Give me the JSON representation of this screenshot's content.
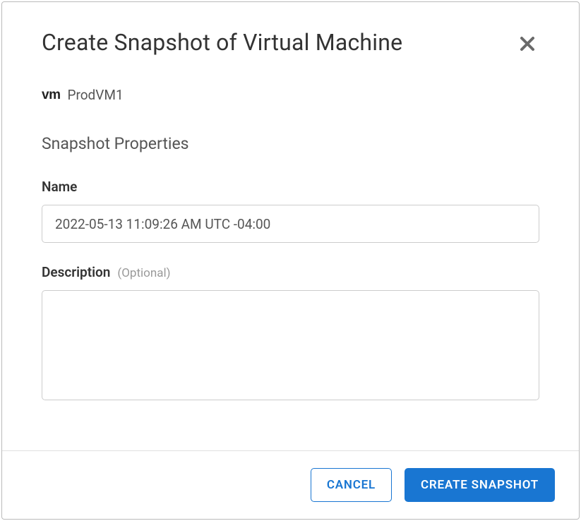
{
  "dialog": {
    "title": "Create Snapshot of Virtual Machine",
    "vm_name": "ProdVM1",
    "section_heading": "Snapshot Properties"
  },
  "form": {
    "name": {
      "label": "Name",
      "value": "2022-05-13 11:09:26 AM UTC -04:00"
    },
    "description": {
      "label": "Description",
      "optional_hint": "(Optional)",
      "value": ""
    }
  },
  "buttons": {
    "cancel": "CANCEL",
    "create": "CREATE SNAPSHOT"
  }
}
